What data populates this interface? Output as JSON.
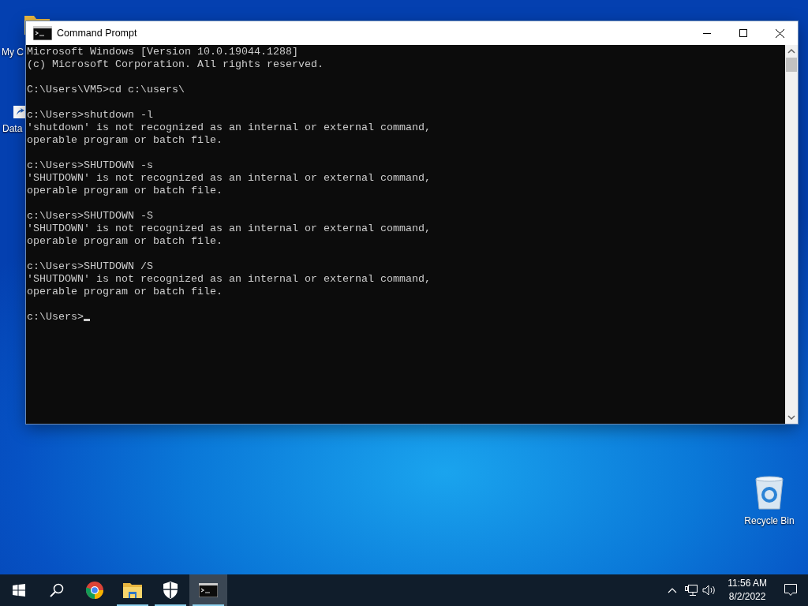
{
  "desktop_icons": [
    {
      "label": "My C",
      "kind": "folder"
    },
    {
      "label": "Data",
      "kind": "shortcut"
    },
    {
      "label": "Recycle Bin",
      "kind": "bin"
    }
  ],
  "window": {
    "title": "Command Prompt",
    "console_blocks": [
      [
        "Microsoft Windows [Version 10.0.19044.1288]",
        "(c) Microsoft Corporation. All rights reserved."
      ],
      [
        "C:\\Users\\VM5>cd c:\\users\\"
      ],
      [
        "c:\\Users>shutdown -l",
        "'shutdown' is not recognized as an internal or external command,",
        "operable program or batch file."
      ],
      [
        "c:\\Users>SHUTDOWN -s",
        "'SHUTDOWN' is not recognized as an internal or external command,",
        "operable program or batch file."
      ],
      [
        "c:\\Users>SHUTDOWN -S",
        "'SHUTDOWN' is not recognized as an internal or external command,",
        "operable program or batch file."
      ],
      [
        "c:\\Users>SHUTDOWN /S",
        "'SHUTDOWN' is not recognized as an internal or external command,",
        "operable program or batch file."
      ],
      [
        "c:\\Users>"
      ]
    ],
    "cursor": true
  },
  "taskbar": {
    "items": [
      {
        "kind": "start",
        "running": false,
        "selected": false
      },
      {
        "kind": "search",
        "running": false,
        "selected": false
      },
      {
        "kind": "chrome",
        "running": false,
        "selected": false
      },
      {
        "kind": "folder",
        "running": true,
        "selected": false
      },
      {
        "kind": "shield",
        "running": true,
        "selected": false
      },
      {
        "kind": "cmd",
        "running": true,
        "selected": true
      }
    ],
    "clock": {
      "time": "11:56 AM",
      "date": "8/2/2022"
    }
  }
}
